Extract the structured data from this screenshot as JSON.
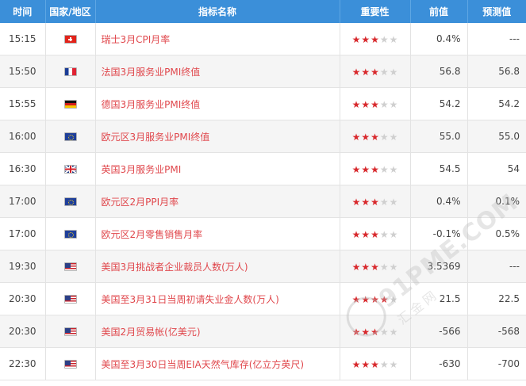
{
  "headers": {
    "time": "时间",
    "country": "国家/地区",
    "event": "指标名称",
    "importance": "重要性",
    "previous": "前值",
    "forecast": "预测值"
  },
  "rows": [
    {
      "time": "15:15",
      "flag": "switzerland-flag-icon",
      "event": "瑞士3月CPI月率",
      "stars": 3,
      "previous": "0.4%",
      "forecast": "---"
    },
    {
      "time": "15:50",
      "flag": "france-flag-icon",
      "event": "法国3月服务业PMI终值",
      "stars": 3,
      "previous": "56.8",
      "forecast": "56.8"
    },
    {
      "time": "15:55",
      "flag": "germany-flag-icon",
      "event": "德国3月服务业PMI终值",
      "stars": 3,
      "previous": "54.2",
      "forecast": "54.2"
    },
    {
      "time": "16:00",
      "flag": "eurozone-flag-icon",
      "event": "欧元区3月服务业PMI终值",
      "stars": 3,
      "previous": "55.0",
      "forecast": "55.0"
    },
    {
      "time": "16:30",
      "flag": "uk-flag-icon",
      "event": "英国3月服务业PMI",
      "stars": 3,
      "previous": "54.5",
      "forecast": "54"
    },
    {
      "time": "17:00",
      "flag": "eurozone-flag-icon",
      "event": "欧元区2月PPI月率",
      "stars": 3,
      "previous": "0.4%",
      "forecast": "0.1%"
    },
    {
      "time": "17:00",
      "flag": "eurozone-flag-icon",
      "event": "欧元区2月零售销售月率",
      "stars": 3,
      "previous": "-0.1%",
      "forecast": "0.5%"
    },
    {
      "time": "19:30",
      "flag": "usa-flag-icon",
      "event": "美国3月挑战者企业裁员人数(万人)",
      "stars": 3,
      "previous": "3.5369",
      "forecast": "---"
    },
    {
      "time": "20:30",
      "flag": "usa-flag-icon",
      "event": "美国至3月31日当周初请失业金人数(万人)",
      "stars": 4,
      "previous": "21.5",
      "forecast": "22.5"
    },
    {
      "time": "20:30",
      "flag": "usa-flag-icon",
      "event": "美国2月贸易帐(亿美元)",
      "stars": 3,
      "previous": "-566",
      "forecast": "-568"
    },
    {
      "time": "22:30",
      "flag": "usa-flag-icon",
      "event": "美国至3月30日当周EIA天然气库存(亿立方英尺)",
      "stars": 3,
      "previous": "-630",
      "forecast": "-700"
    }
  ],
  "watermark": {
    "main": "91PME.COM",
    "sub": "汇金网"
  },
  "colors": {
    "header_bg": "#3b8fd9",
    "event_text": "#e0474c",
    "star_on": "#d8282c",
    "star_off": "#cfcfcf",
    "row_alt": "#f5f5f5"
  }
}
